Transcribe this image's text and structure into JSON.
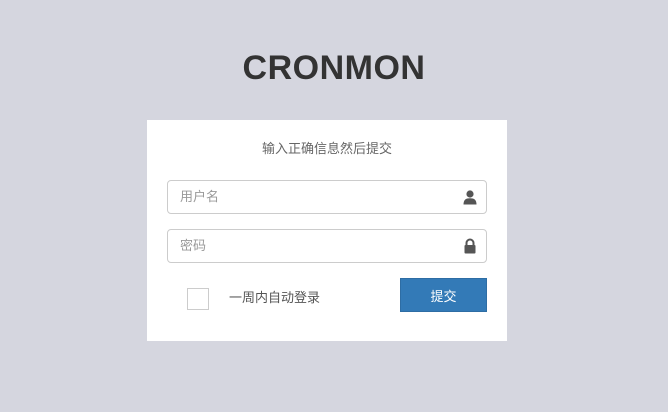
{
  "app": {
    "logo_text": "CRONMON"
  },
  "login": {
    "message": "输入正确信息然后提交",
    "username": {
      "placeholder": "用户名",
      "value": "",
      "icon": "user-icon"
    },
    "password": {
      "placeholder": "密码",
      "value": "",
      "icon": "lock-icon"
    },
    "remember": {
      "label": "一周内自动登录",
      "checked": false
    },
    "submit_label": "提交"
  },
  "colors": {
    "page_background": "#d5d6df",
    "panel_background": "#ffffff",
    "primary_button": "#337ab7",
    "logo_text": "#333333"
  }
}
